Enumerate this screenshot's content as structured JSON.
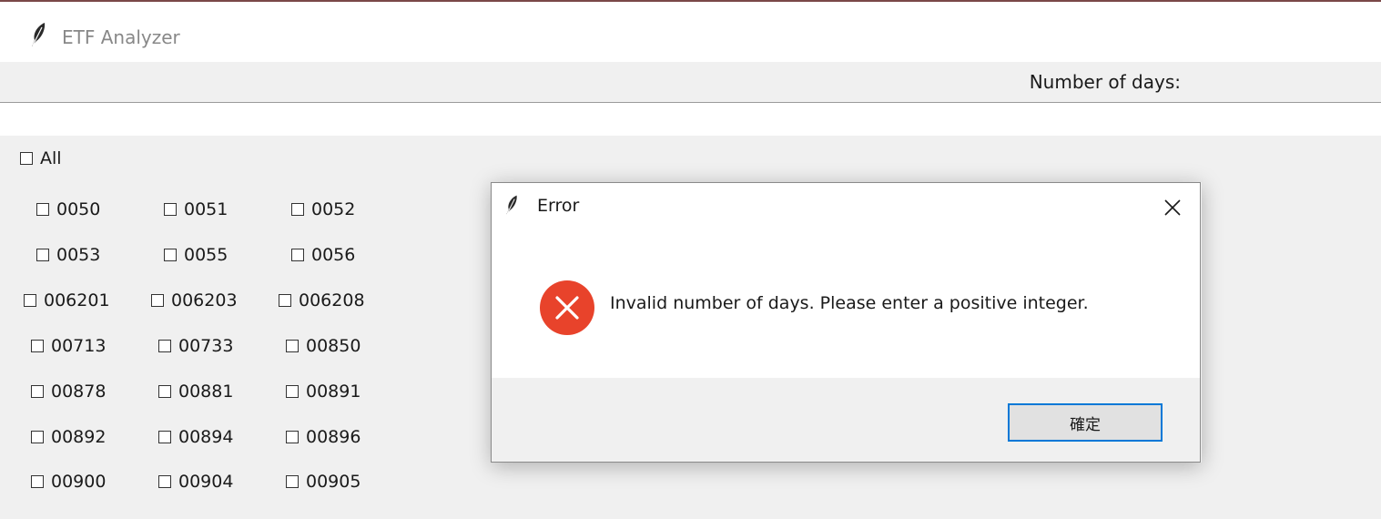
{
  "app": {
    "title": "ETF Analyzer"
  },
  "toolbar": {
    "days_label": "Number of days:"
  },
  "checkboxes": {
    "all_label": "All",
    "rows": [
      [
        "0050",
        "0051",
        "0052"
      ],
      [
        "0053",
        "0055",
        "0056"
      ],
      [
        "006201",
        "006203",
        "006208"
      ],
      [
        "00713",
        "00733",
        "00850"
      ],
      [
        "00878",
        "00881",
        "00891"
      ],
      [
        "00892",
        "00894",
        "00896"
      ],
      [
        "00900",
        "00904",
        "00905"
      ]
    ]
  },
  "dialog": {
    "title": "Error",
    "message": "Invalid number of days. Please enter a positive integer.",
    "ok_label": "確定"
  },
  "colors": {
    "error_red": "#e8432b",
    "focus_blue": "#0078d7",
    "panel_bg": "#f0f0f0",
    "top_border": "#7a4848"
  },
  "icons": {
    "app": "feather-icon",
    "dialog": "feather-icon",
    "close": "close-icon",
    "error": "error-icon"
  }
}
